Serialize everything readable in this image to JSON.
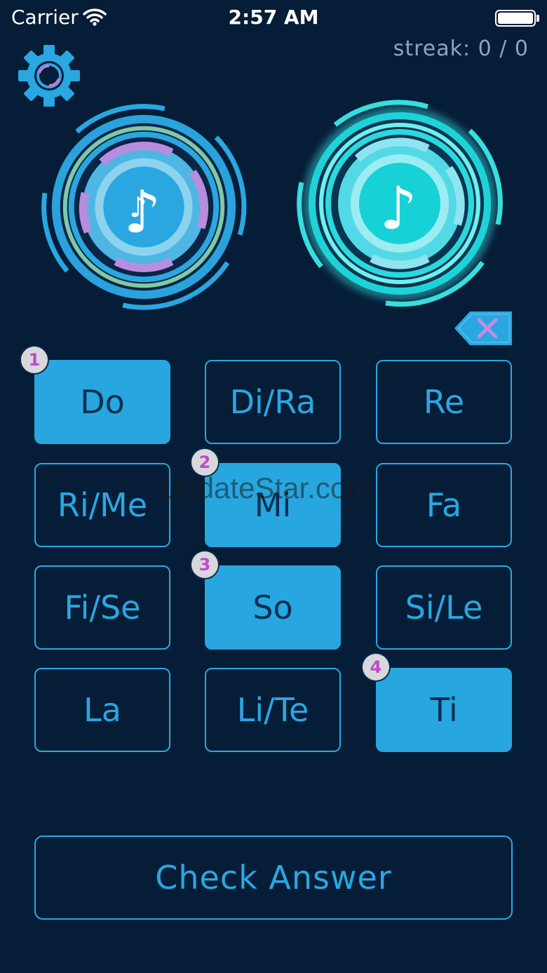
{
  "status_bar": {
    "carrier": "Carrier",
    "time": "2:57 AM"
  },
  "header": {
    "streak": "streak: 0 / 0"
  },
  "icons": {
    "settings": "gear-icon",
    "played_interval": "music-note-icon",
    "target_note": "music-note-icon",
    "backspace": "backspace-icon"
  },
  "keys": [
    {
      "label": "Do",
      "selected": true,
      "order": "1"
    },
    {
      "label": "Di/Ra",
      "selected": false
    },
    {
      "label": "Re",
      "selected": false
    },
    {
      "label": "Ri/Me",
      "selected": false
    },
    {
      "label": "Mi",
      "selected": true,
      "order": "2"
    },
    {
      "label": "Fa",
      "selected": false
    },
    {
      "label": "Fi/Se",
      "selected": false
    },
    {
      "label": "So",
      "selected": true,
      "order": "3"
    },
    {
      "label": "Si/Le",
      "selected": false
    },
    {
      "label": "La",
      "selected": false
    },
    {
      "label": "Li/Te",
      "selected": false
    },
    {
      "label": "Ti",
      "selected": true,
      "order": "4"
    }
  ],
  "actions": {
    "check_answer": "Check Answer"
  },
  "watermark": "UpdateStar.com",
  "colors": {
    "background": "#061d38",
    "accent": "#29a9e0",
    "accent_bright": "#2fe0e0",
    "badge_text": "#c049c9"
  }
}
